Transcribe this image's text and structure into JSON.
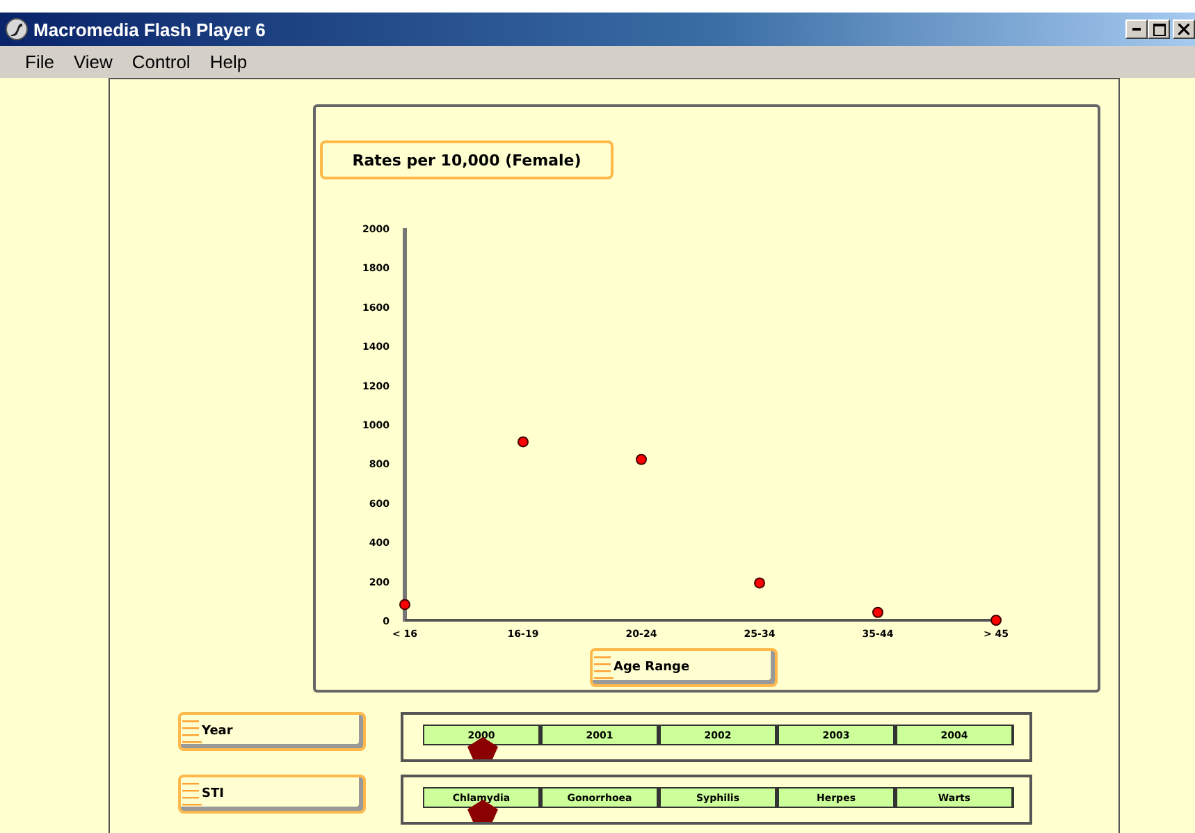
{
  "window": {
    "title": "Macromedia Flash Player 6"
  },
  "menu": [
    "File",
    "View",
    "Control",
    "Help"
  ],
  "chart": {
    "chart_data": {
      "type": "scatter",
      "title": "Rates per 10,000 (Female)",
      "xlabel": "Age Range",
      "categories": [
        "< 16",
        "16-19",
        "20-24",
        "25-34",
        "35-44",
        "> 45"
      ],
      "series": [
        {
          "color": "#ff0000",
          "values": [
            80,
            910,
            820,
            190,
            40,
            0
          ]
        }
      ],
      "ylim": [
        0,
        2000
      ],
      "yticks": [
        0,
        200,
        400,
        600,
        800,
        1000,
        1200,
        1400,
        1600,
        1800,
        2000
      ]
    }
  },
  "selectors": [
    {
      "label": "Year",
      "options": [
        {
          "label": "2000",
          "selected": true
        },
        {
          "label": "2001",
          "selected": false
        },
        {
          "label": "2002",
          "selected": false
        },
        {
          "label": "2003",
          "selected": false
        },
        {
          "label": "2004",
          "selected": false
        }
      ]
    },
    {
      "label": "STI",
      "options": [
        {
          "label": "Chlamydia",
          "selected": true
        },
        {
          "label": "Gonorrhoea",
          "selected": false
        },
        {
          "label": "Syphilis",
          "selected": false
        },
        {
          "label": "Herpes",
          "selected": false
        },
        {
          "label": "Warts",
          "selected": false
        }
      ]
    }
  ]
}
